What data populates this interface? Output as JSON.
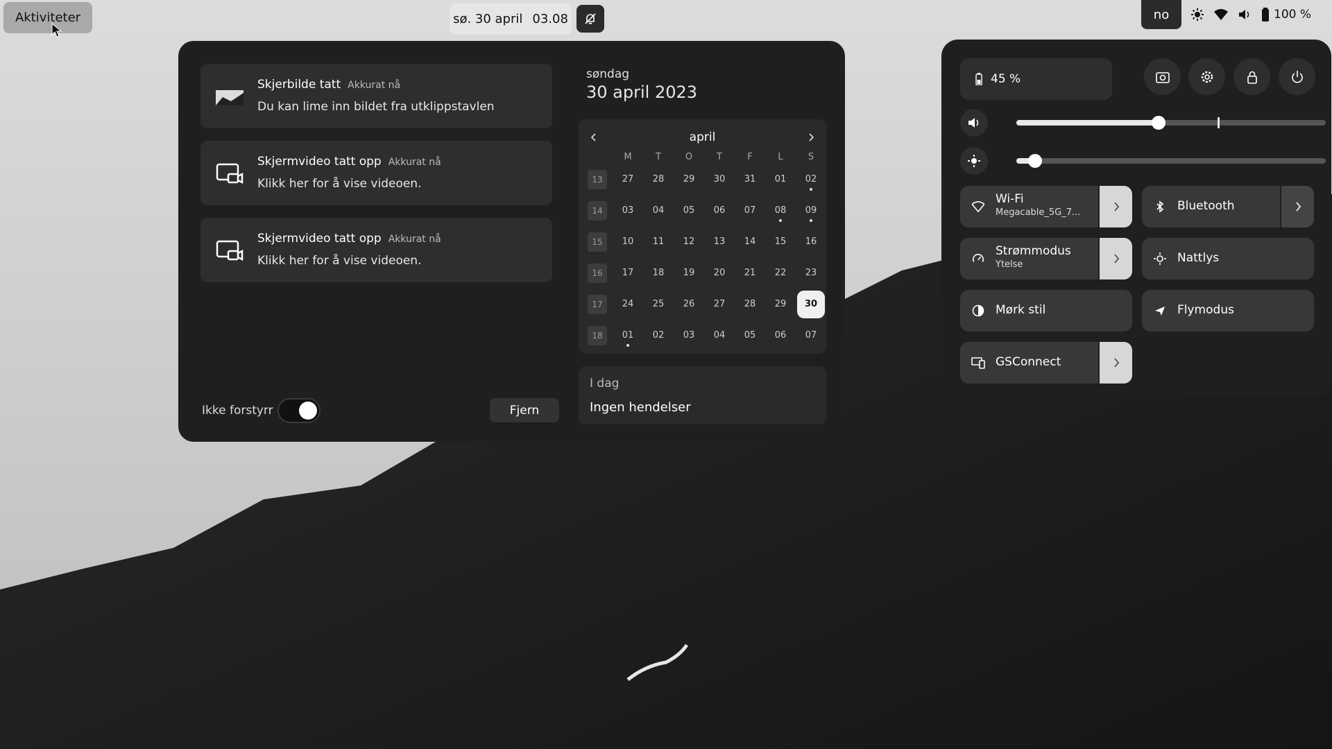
{
  "topbar": {
    "activities_label": "Aktiviteter",
    "clock_date": "sø. 30 april",
    "clock_time": "03.08",
    "language": "no",
    "battery_label": "100 %"
  },
  "notifications": [
    {
      "title": "Skjerbilde tatt",
      "time": "Akkurat nå",
      "body": "Du kan lime inn bildet fra utklippstavlen",
      "icon": "screenshot-thumbnail-icon"
    },
    {
      "title": "Skjermvideo tatt opp",
      "time": "Akkurat nå",
      "body": "Klikk her for å vise videoen.",
      "icon": "screencast-icon"
    },
    {
      "title": "Skjermvideo tatt opp",
      "time": "Akkurat nå",
      "body": "Klikk her for å vise videoen.",
      "icon": "screencast-icon"
    }
  ],
  "dnd": {
    "label": "Ikke forstyrr",
    "enabled": true
  },
  "clear_label": "Fjern",
  "calendar": {
    "day_name": "søndag",
    "full_date": "30 april 2023",
    "month": "april",
    "weekdays": [
      "M",
      "T",
      "O",
      "T",
      "F",
      "L",
      "S"
    ],
    "weeks": [
      {
        "week": "13",
        "days": [
          "27",
          "28",
          "29",
          "30",
          "31",
          "01",
          "02"
        ],
        "dots": [
          6
        ]
      },
      {
        "week": "14",
        "days": [
          "03",
          "04",
          "05",
          "06",
          "07",
          "08",
          "09"
        ],
        "dots": [
          5,
          6
        ]
      },
      {
        "week": "15",
        "days": [
          "10",
          "11",
          "12",
          "13",
          "14",
          "15",
          "16"
        ],
        "dots": []
      },
      {
        "week": "16",
        "days": [
          "17",
          "18",
          "19",
          "20",
          "21",
          "22",
          "23"
        ],
        "dots": []
      },
      {
        "week": "17",
        "days": [
          "24",
          "25",
          "26",
          "27",
          "28",
          "29",
          "30"
        ],
        "dots": [],
        "today": 6
      },
      {
        "week": "18",
        "days": [
          "01",
          "02",
          "03",
          "04",
          "05",
          "06",
          "07"
        ],
        "dots": [
          0
        ]
      }
    ]
  },
  "events": {
    "heading": "I dag",
    "text": "Ingen hendelser"
  },
  "quick_settings": {
    "battery_percent": "45 %",
    "volume_level": 0.46,
    "volume_mark": 0.65,
    "brightness_level": 0.06,
    "tiles": {
      "wifi": {
        "label": "Wi-Fi",
        "sub": "Megacable_5G_7..."
      },
      "bluetooth": {
        "label": "Bluetooth"
      },
      "power": {
        "label": "Strømmodus",
        "sub": "Ytelse"
      },
      "night": {
        "label": "Nattlys"
      },
      "dark": {
        "label": "Mørk stil"
      },
      "airplane": {
        "label": "Flymodus"
      },
      "gsconnect": {
        "label": "GSConnect"
      }
    }
  },
  "colors": {
    "panel": "#1f1f1f",
    "tile_on": "#d7d7d7",
    "tile_off": "#383838"
  }
}
